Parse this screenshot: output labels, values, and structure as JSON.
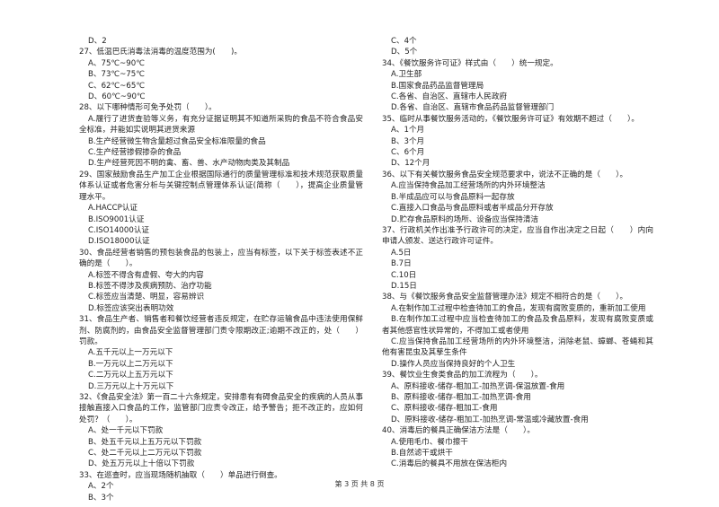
{
  "left": [
    {
      "kind": "o",
      "text": "D、2"
    },
    {
      "kind": "q",
      "text": "27、低温巴氏消毒法消毒的温度范围为(　　)。"
    },
    {
      "kind": "o",
      "text": "A、75℃~90℃"
    },
    {
      "kind": "o",
      "text": "B、73℃~75℃"
    },
    {
      "kind": "o",
      "text": "C、62℃~65℃"
    },
    {
      "kind": "o",
      "text": "D、60℃~90℃"
    },
    {
      "kind": "q",
      "text": "28、以下哪种情形可免予处罚（　　）。"
    },
    {
      "kind": "o",
      "text": "A.履行了进货查验等义务，有充分证据证明其不知道所采购的食品不符合食品安全标准，并能如实说明其进货来源"
    },
    {
      "kind": "o",
      "text": "B.生产经营微生物含量超过食品安全标准限量的食品"
    },
    {
      "kind": "o",
      "text": "C.生产经营掺假掺杂的食品"
    },
    {
      "kind": "o",
      "text": "D.生产经营死因不明的禽、畜、兽、水产动物肉类及其制品"
    },
    {
      "kind": "q",
      "text": "29、国家鼓励食品生产加工企业根据国际通行的质量管理标准和技术规范获取质量体系认证或者危害分析与关键控制点管理体系认证(简称（　　），提高企业质量管理水平。"
    },
    {
      "kind": "o",
      "text": "A.HACCP认证"
    },
    {
      "kind": "o",
      "text": "B.ISO9001认证"
    },
    {
      "kind": "o",
      "text": "C.ISO14000认证"
    },
    {
      "kind": "o",
      "text": "D.ISO18000认证"
    },
    {
      "kind": "q",
      "text": "30、食品经营者销售的预包装食品的包装上，应当有标签，以下关于标签表述不正确的是（　　）。"
    },
    {
      "kind": "o",
      "text": "A.标签不得含有虚假、夸大的内容"
    },
    {
      "kind": "o",
      "text": "B.标签不得涉及疾病预防、治疗功能"
    },
    {
      "kind": "o",
      "text": "C.标签应当清楚、明显，容易辨识"
    },
    {
      "kind": "o",
      "text": "D.标签应该突出表明功效"
    },
    {
      "kind": "q",
      "text": "31、食品生产者、销售者和餐饮经营者违反规定，在贮存运输食品中违法使用保鲜剂、防腐剂的，由食品安全监督管理部门责令限期改正;逾期不改正的，处（　　）罚款。"
    },
    {
      "kind": "o",
      "text": "A.五千元以上一万元以下"
    },
    {
      "kind": "o",
      "text": "B.一万元以上二万元以下"
    },
    {
      "kind": "o",
      "text": "C.二万元以上五万元以下"
    },
    {
      "kind": "o",
      "text": "D.三万元以上十万元以下"
    },
    {
      "kind": "q",
      "text": "32、《食品安全法》第一百二十六条规定，安排患有有碍食品安全的疾病的人员从事接触直接入口食品的工作，监管部门应责令改正，给予警告；拒不改正的，应如何处罚？（　　）。"
    },
    {
      "kind": "o",
      "text": "A、处一千元以下罚款"
    },
    {
      "kind": "o",
      "text": "B、处五千元以上五万元以下罚款"
    },
    {
      "kind": "o",
      "text": "C、处二千元以上二万元以下罚款"
    },
    {
      "kind": "o",
      "text": "D、处五万元以上十倍以下罚款"
    },
    {
      "kind": "q",
      "text": "33、在巡查时，应当现场随机抽取（　　）单品进行倒查。"
    },
    {
      "kind": "o",
      "text": "A、2个"
    },
    {
      "kind": "o",
      "text": "B、3个"
    }
  ],
  "right": [
    {
      "kind": "o",
      "text": "C、4个"
    },
    {
      "kind": "o",
      "text": "D、5个"
    },
    {
      "kind": "q",
      "text": "34、《餐饮服务许可证》样式由（　　）统一规定。"
    },
    {
      "kind": "o",
      "text": "A.卫生部"
    },
    {
      "kind": "o",
      "text": "B.国家食品药品监督管理局"
    },
    {
      "kind": "o",
      "text": "C.各省、自治区、直辖市人民政府"
    },
    {
      "kind": "o",
      "text": "D.各省、自治区、直辖市食品药品监督管理部门"
    },
    {
      "kind": "q",
      "text": "35、临时从事餐饮服务活动的，《餐饮服务许可证》有效期不超过（　　）。"
    },
    {
      "kind": "o",
      "text": "A、1个月"
    },
    {
      "kind": "o",
      "text": "B、3个月"
    },
    {
      "kind": "o",
      "text": "C、6个月"
    },
    {
      "kind": "o",
      "text": "D、12个月"
    },
    {
      "kind": "q",
      "text": "36、以下有关餐饮服务食品安全规范要求中，说法不正确的是（　　）。"
    },
    {
      "kind": "o",
      "text": "A.应当保持食品加工经营场所的内外环境整洁"
    },
    {
      "kind": "o",
      "text": "B.半成品应可以与食品原料一起存放"
    },
    {
      "kind": "o",
      "text": "C.直接入口食品与食品原料或者半成品分开存放"
    },
    {
      "kind": "o",
      "text": "D.贮存食品原料的场所、设备应当保持清洁"
    },
    {
      "kind": "q",
      "text": "37、行政机关作出准予行政许可的决定，应当自作出决定之日起（　　）内向申请人颁发、送达行政许可证件。"
    },
    {
      "kind": "o",
      "text": "A.5日"
    },
    {
      "kind": "o",
      "text": "B.7日"
    },
    {
      "kind": "o",
      "text": "C.10日"
    },
    {
      "kind": "o",
      "text": "D.15日"
    },
    {
      "kind": "q",
      "text": "38、与《餐饮服务食品安全监督管理办法》规定不相符合的是（　　）。"
    },
    {
      "kind": "o",
      "text": "A.在制作加工过程中检查待加工的食品，发现有腐败变质的，重新加工使用"
    },
    {
      "kind": "o",
      "text": "B.在制作加工过程中应当检查待加工的食品及食品原料，发现有腐败变质或者其他感官性状异常的，不得加工或者使用"
    },
    {
      "kind": "o",
      "text": "C.应当保持食品加工经营场所的内外环境整洁，消除老鼠、蟑螂、苍蝇和其他有害昆虫及其孳生条件"
    },
    {
      "kind": "o",
      "text": "D.操作人员应当保持良好的个人卫生"
    },
    {
      "kind": "q",
      "text": "39、餐饮业生食类食品的加工流程为（　　）。"
    },
    {
      "kind": "o",
      "text": "A、原料接收-储存-粗加工-加热烹调-保温放置-食用"
    },
    {
      "kind": "o",
      "text": "B、原料接收-储存-粗加工-加热烹调-食用"
    },
    {
      "kind": "o",
      "text": "C、原料接收-储存-粗加工-食用"
    },
    {
      "kind": "o",
      "text": "D、原料接收-储存-粗加工-加热烹调-常温或冷藏放置-食用"
    },
    {
      "kind": "q",
      "text": "40、消毒后的餐具正确保洁方法是（　　）。"
    },
    {
      "kind": "o",
      "text": "A.使用毛巾、餐巾擦干"
    },
    {
      "kind": "o",
      "text": "B.自然滤干或烘干"
    },
    {
      "kind": "o",
      "text": "C.消毒后的餐具不用放在保洁柜内"
    }
  ],
  "footer": "第 3 页 共 8 页"
}
